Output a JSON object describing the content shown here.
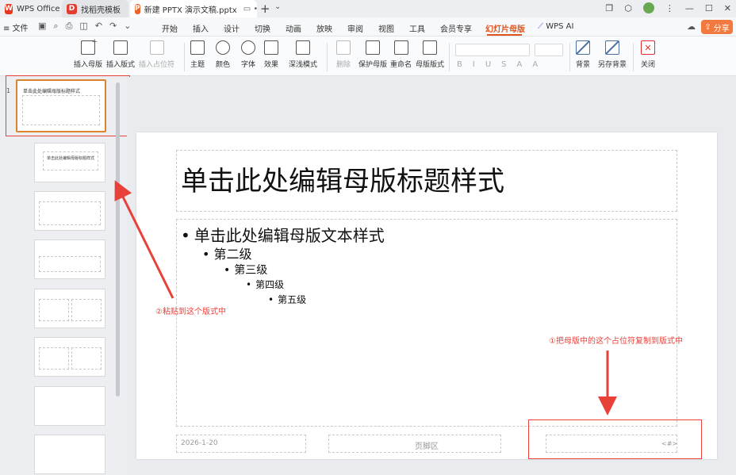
{
  "tabs": {
    "wps": "WPS Office",
    "template": "找稻壳模板",
    "doc": "新建 PPTX 演示文稿.pptx"
  },
  "menubar": {
    "file": "≡ 文件",
    "items": [
      "开始",
      "插入",
      "设计",
      "切换",
      "动画",
      "放映",
      "审阅",
      "视图",
      "工具",
      "会员专享",
      "幻灯片母版"
    ],
    "wps_ai": "WPS AI",
    "share": "分享"
  },
  "ribbon": {
    "insert_master": "插入母版",
    "insert_layout": "插入版式",
    "insert_placeholder": "插入占位符",
    "theme": "主题",
    "color": "颜色",
    "font": "字体",
    "effect": "效果",
    "depth_mode": "深浅模式",
    "delete": "删除",
    "protect_master": "保护母版",
    "rename": "重命名",
    "master_layout": "母版版式",
    "bold": "B",
    "italic": "I",
    "underline": "U",
    "strike": "S",
    "a_plus": "A",
    "a_minus": "A",
    "background": "背景",
    "save_background": "另存背景",
    "close": "关闭"
  },
  "panel": {
    "slide_number": "1",
    "thumb_title": "单击此处编辑母版标题样式",
    "thumb_layout_title": "单击此处编辑母版标题样式"
  },
  "slide": {
    "title": "单击此处编辑母版标题样式",
    "levels": [
      "单击此处编辑母版文本样式",
      "第二级",
      "第三级",
      "第四级",
      "第五级"
    ],
    "bullet": "•",
    "date": "2026-1-20",
    "footer": "页脚区",
    "number": "<#>"
  },
  "annotations": {
    "note1": "①把母版中的这个占位符复制到版式中",
    "note2": "②粘贴到这个版式中"
  },
  "colors": {
    "accent": "#e0551f",
    "annotation_red": "#e8413a",
    "selection_orange": "#d9852c"
  }
}
